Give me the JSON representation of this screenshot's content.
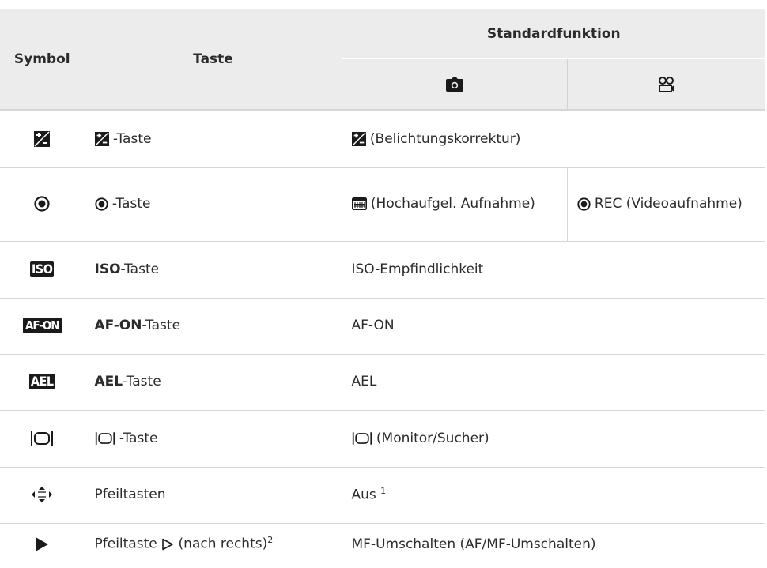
{
  "header": {
    "symbol": "Symbol",
    "taste": "Taste",
    "standardfunktion": "Standardfunktion",
    "photo_icon": "camera-icon",
    "video_icon": "movie-icon"
  },
  "rows": [
    {
      "symbol_icon": "exposure-compensation-icon",
      "taste_text": "-Taste",
      "function": "(Belichtungskorrektur)"
    },
    {
      "symbol_icon": "record-icon",
      "taste_text": "-Taste",
      "function_photo": "(Hochaufgel. Aufnahme)",
      "function_video": "REC (Videoaufnahme)"
    },
    {
      "symbol_text": "ISO",
      "taste_bold": "ISO",
      "taste_text": "-Taste",
      "function": "ISO-Empfindlichkeit"
    },
    {
      "symbol_text": "AF-ON",
      "taste_bold": "AF-ON",
      "taste_text": "-Taste",
      "function": "AF-ON"
    },
    {
      "symbol_text": "AEL",
      "taste_bold": "AEL",
      "taste_text": "-Taste",
      "function": "AEL"
    },
    {
      "symbol_icon": "monitor-viewfinder-icon",
      "taste_text": "-Taste",
      "function": "(Monitor/Sucher)"
    },
    {
      "symbol_icon": "arrow-pad-icon",
      "taste_text": "Pfeiltasten",
      "function": "Aus",
      "function_sup": "1"
    },
    {
      "symbol_icon": "play-icon",
      "taste_text": "Pfeiltaste",
      "taste_text_2": "(nach rechts)",
      "taste_sup": "2",
      "function": "MF-Umschalten (AF/MF-Umschalten)"
    }
  ]
}
